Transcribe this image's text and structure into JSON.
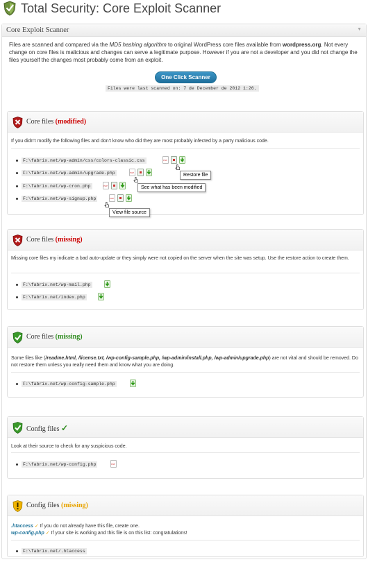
{
  "header": {
    "title": "Total Security: Core Exploit Scanner"
  },
  "main": {
    "panel_title": "Core Exploit Scanner",
    "intro_1": "Files are scanned and compared via the ",
    "intro_em": "MD5 hashing algorithm",
    "intro_2": " to original WordPress core files available from ",
    "intro_b": "wordpress.org",
    "intro_3": ". Not every change on core files is malicious and changes can serve a legitimate purpose. However if you are not a developer and you did not change the files yourself the changes most probably come from an exploit.",
    "scan_button": "One Click Scanner",
    "scan_status": "Files were last scanned on: 7 de December de 2012 1:26."
  },
  "sections": {
    "modified": {
      "title": "Core files",
      "status": "(modified)",
      "desc": "If you didn't modify the following files and don't know who did they are most probably infected by a party malicious code.",
      "files": [
        "F:\\fabrix.net/wp-admin/css/colors-classic.css",
        "F:\\fabrix.net/wp-admin/upgrade.php",
        "F:\\fabrix.net/wp-cron.php",
        "F:\\fabrix.net/wp-signup.php"
      ],
      "tooltip_restore": "Restore file",
      "tooltip_diff": "See what has been modified",
      "tooltip_source": "View file source"
    },
    "missing": {
      "title": "Core files",
      "status": "(missing)",
      "desc": "Missing core files my indicate a bad auto-update or they simply were not copied on the server when the site was setup. Use the restore action to create them.",
      "files": [
        "F:\\fabrix.net/wp-mail.php",
        "F:\\fabrix.net/index.php"
      ]
    },
    "missing_ok": {
      "title": "Core files",
      "status": "(missing)",
      "desc_1": "Some files like (",
      "desc_b": "/readme.html, /license.txt, /wp-config-sample.php, /wp-admin/install.php, /wp-admin/upgrade.php",
      "desc_2": ") are not vital and should be removed. Do not restore them unless you really need them and know what you are doing.",
      "files": [
        "F:\\fabrix.net/wp-config-sample.php"
      ]
    },
    "config": {
      "title": "Config files",
      "status": "✓",
      "desc": "Look at their source to check for any suspicious code.",
      "files": [
        "F:\\fabrix.net/wp-config.php"
      ]
    },
    "config_missing": {
      "title": "Config files",
      "status": "(missing)",
      "line1_file": ".htaccess",
      "line1_check": "✓",
      "line1_text": " If you do not already have this file, create one.",
      "line2_file": "wp-config.php",
      "line2_check": "✓",
      "line2_text": " If your site is working and this file is on this list: congratulations!",
      "files": [
        "F:\\fabrix.net/.htaccess"
      ]
    }
  },
  "colors": {
    "danger": "#cc0000",
    "ok": "#2e8b1e",
    "warning": "#e8a400",
    "button": "#2a7fb0"
  },
  "icons": {
    "logo": "shield-check-icon",
    "danger": "red-shield-x-icon",
    "ok": "green-shield-check-icon",
    "warning": "yellow-shield-exclamation-icon",
    "view_source": "php-file-icon",
    "diff": "diff-icon",
    "restore": "green-download-arrow-icon",
    "cursor": "hand-pointer-icon"
  }
}
